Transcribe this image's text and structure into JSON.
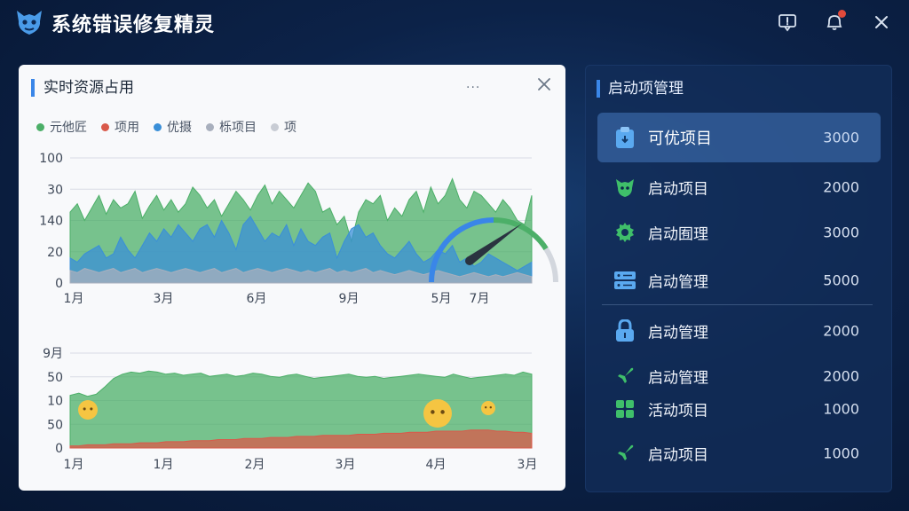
{
  "app": {
    "title": "系统错误修复精灵"
  },
  "colors": {
    "accent": "#3a86e8",
    "green": "#4caf68",
    "red": "#d9594a",
    "blue": "#3a8fd8",
    "gray": "#a8afbd",
    "lightgray": "#c8ccd4",
    "gold": "#f5c542"
  },
  "left_card": {
    "title": "实时资源占用",
    "more": "···",
    "legend": [
      {
        "label": "元他匠",
        "color": "#4caf68"
      },
      {
        "label": "项用",
        "color": "#d9594a"
      },
      {
        "label": "优摄",
        "color": "#3a8fd8"
      },
      {
        "label": "栎项目",
        "color": "#a8afbd"
      },
      {
        "label": "项",
        "color": "#c8ccd4"
      }
    ]
  },
  "chart_data": [
    {
      "type": "area",
      "y_tick_labels": [
        "100",
        "30",
        "140",
        "20",
        "0"
      ],
      "x_tick_labels": [
        "1月",
        "3月",
        "6月",
        "9月",
        "5月",
        "7月"
      ],
      "series": [
        {
          "color": "#4caf68",
          "values": [
            34,
            38,
            30,
            36,
            42,
            33,
            40,
            36,
            38,
            44,
            31,
            37,
            42,
            35,
            40,
            34,
            38,
            46,
            42,
            36,
            40,
            32,
            38,
            44,
            40,
            35,
            42,
            47,
            38,
            44,
            40,
            36,
            42,
            48,
            44,
            34,
            36,
            28,
            32,
            20,
            34,
            40,
            38,
            42,
            30,
            36,
            32,
            40,
            44,
            34,
            46,
            38,
            42,
            50,
            40,
            36,
            44,
            42,
            38,
            34,
            40,
            36,
            30,
            28,
            42
          ]
        },
        {
          "color": "#3a8fd8",
          "values": [
            12,
            10,
            14,
            16,
            18,
            12,
            14,
            22,
            16,
            12,
            18,
            24,
            20,
            26,
            22,
            28,
            24,
            20,
            26,
            28,
            22,
            30,
            24,
            16,
            28,
            32,
            26,
            20,
            24,
            22,
            28,
            18,
            26,
            20,
            18,
            22,
            24,
            12,
            20,
            26,
            28,
            22,
            24,
            18,
            14,
            12,
            16,
            20,
            14,
            10,
            12,
            16,
            14,
            18,
            10,
            12,
            8,
            10,
            14,
            12,
            10,
            8,
            6,
            8,
            10
          ]
        },
        {
          "color": "#a8afbd",
          "values": [
            6,
            5,
            7,
            6,
            5,
            6,
            7,
            5,
            6,
            7,
            5,
            6,
            7,
            6,
            5,
            6,
            7,
            6,
            5,
            6,
            7,
            5,
            6,
            7,
            5,
            6,
            7,
            6,
            5,
            6,
            7,
            6,
            5,
            6,
            5,
            6,
            7,
            5,
            6,
            5,
            6,
            7,
            5,
            6,
            5,
            4,
            5,
            6,
            5,
            4,
            5,
            6,
            5,
            4,
            3,
            4,
            5,
            4,
            3,
            4,
            3,
            4,
            5,
            4,
            3
          ]
        }
      ]
    },
    {
      "type": "area",
      "y_tick_labels": [
        "9月",
        "50",
        "10",
        "50",
        "0"
      ],
      "x_tick_labels": [
        "1月",
        "1月",
        "2月",
        "3月",
        "4月",
        "3月"
      ],
      "series": [
        {
          "color": "#4caf68",
          "values": [
            50,
            52,
            49,
            51,
            58,
            66,
            70,
            72,
            71,
            73,
            72,
            70,
            71,
            69,
            70,
            71,
            68,
            69,
            70,
            68,
            69,
            71,
            70,
            68,
            67,
            69,
            70,
            68,
            66,
            67,
            68,
            69,
            70,
            68,
            67,
            68,
            66,
            67,
            68,
            69,
            70,
            69,
            68,
            67,
            70,
            68,
            66,
            67,
            68,
            69,
            70,
            69,
            72,
            70
          ]
        },
        {
          "color": "#d9594a",
          "values": [
            2,
            2,
            3,
            3,
            3,
            4,
            4,
            4,
            5,
            5,
            5,
            6,
            6,
            6,
            7,
            7,
            7,
            8,
            8,
            8,
            9,
            9,
            9,
            10,
            10,
            10,
            11,
            11,
            11,
            12,
            12,
            12,
            12,
            13,
            13,
            13,
            14,
            14,
            14,
            15,
            15,
            15,
            16,
            16,
            16,
            16,
            17,
            17,
            17,
            16,
            16,
            15,
            15,
            14
          ]
        }
      ]
    }
  ],
  "right_panel": {
    "title": "启动项管理",
    "items": [
      {
        "label": "可优项目",
        "value": "3000",
        "icon": "clipboard-icon"
      },
      {
        "label": "启动项目",
        "value": "2000",
        "icon": "mascot-icon"
      },
      {
        "label": "启动囿理",
        "value": "3000",
        "icon": "gear-icon"
      },
      {
        "label": "启动管理",
        "value": "5000",
        "icon": "server-icon"
      },
      {
        "label": "启动管理",
        "value": "2000",
        "icon": "lock-icon"
      },
      {
        "label": "启动管理",
        "value": "2000",
        "icon": "plane-icon"
      },
      {
        "label": "活动项目",
        "value": "1000",
        "icon": "grid-icon"
      },
      {
        "label": "启动项目",
        "value": "1000",
        "icon": "plane-icon"
      }
    ]
  }
}
